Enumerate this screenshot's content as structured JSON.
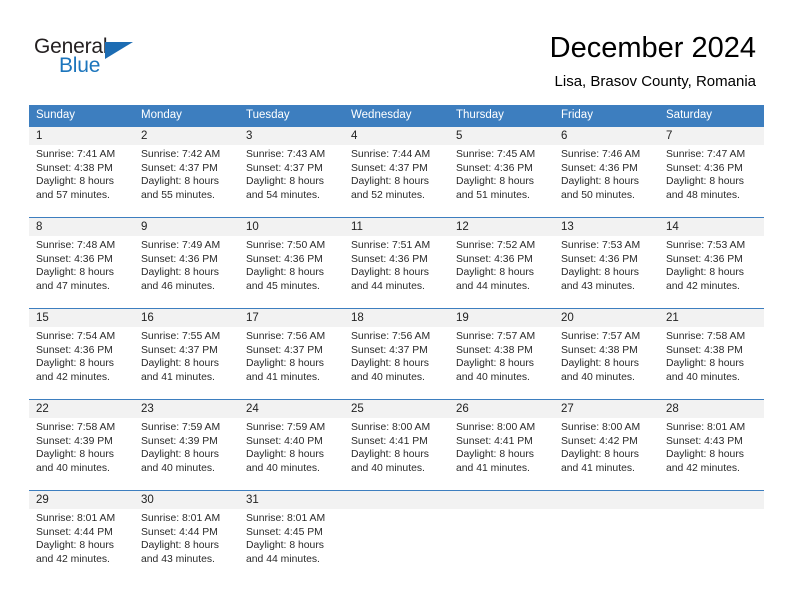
{
  "brand": {
    "name_top": "General",
    "name_bottom": "Blue",
    "triangle_color": "#1c6cb3",
    "blue_color": "#1c75bc"
  },
  "header": {
    "title": "December 2024",
    "subtitle": "Lisa, Brasov County, Romania"
  },
  "theme": {
    "header_bg": "#3d7ebf",
    "daynum_bg": "#f2f2f2",
    "cell_bg": "#ffffff",
    "text": "#2a2a2a"
  },
  "weekdays": [
    "Sunday",
    "Monday",
    "Tuesday",
    "Wednesday",
    "Thursday",
    "Friday",
    "Saturday"
  ],
  "weeks": [
    [
      {
        "day": "1",
        "sunrise": "Sunrise: 7:41 AM",
        "sunset": "Sunset: 4:38 PM",
        "daylight1": "Daylight: 8 hours",
        "daylight2": "and 57 minutes."
      },
      {
        "day": "2",
        "sunrise": "Sunrise: 7:42 AM",
        "sunset": "Sunset: 4:37 PM",
        "daylight1": "Daylight: 8 hours",
        "daylight2": "and 55 minutes."
      },
      {
        "day": "3",
        "sunrise": "Sunrise: 7:43 AM",
        "sunset": "Sunset: 4:37 PM",
        "daylight1": "Daylight: 8 hours",
        "daylight2": "and 54 minutes."
      },
      {
        "day": "4",
        "sunrise": "Sunrise: 7:44 AM",
        "sunset": "Sunset: 4:37 PM",
        "daylight1": "Daylight: 8 hours",
        "daylight2": "and 52 minutes."
      },
      {
        "day": "5",
        "sunrise": "Sunrise: 7:45 AM",
        "sunset": "Sunset: 4:36 PM",
        "daylight1": "Daylight: 8 hours",
        "daylight2": "and 51 minutes."
      },
      {
        "day": "6",
        "sunrise": "Sunrise: 7:46 AM",
        "sunset": "Sunset: 4:36 PM",
        "daylight1": "Daylight: 8 hours",
        "daylight2": "and 50 minutes."
      },
      {
        "day": "7",
        "sunrise": "Sunrise: 7:47 AM",
        "sunset": "Sunset: 4:36 PM",
        "daylight1": "Daylight: 8 hours",
        "daylight2": "and 48 minutes."
      }
    ],
    [
      {
        "day": "8",
        "sunrise": "Sunrise: 7:48 AM",
        "sunset": "Sunset: 4:36 PM",
        "daylight1": "Daylight: 8 hours",
        "daylight2": "and 47 minutes."
      },
      {
        "day": "9",
        "sunrise": "Sunrise: 7:49 AM",
        "sunset": "Sunset: 4:36 PM",
        "daylight1": "Daylight: 8 hours",
        "daylight2": "and 46 minutes."
      },
      {
        "day": "10",
        "sunrise": "Sunrise: 7:50 AM",
        "sunset": "Sunset: 4:36 PM",
        "daylight1": "Daylight: 8 hours",
        "daylight2": "and 45 minutes."
      },
      {
        "day": "11",
        "sunrise": "Sunrise: 7:51 AM",
        "sunset": "Sunset: 4:36 PM",
        "daylight1": "Daylight: 8 hours",
        "daylight2": "and 44 minutes."
      },
      {
        "day": "12",
        "sunrise": "Sunrise: 7:52 AM",
        "sunset": "Sunset: 4:36 PM",
        "daylight1": "Daylight: 8 hours",
        "daylight2": "and 44 minutes."
      },
      {
        "day": "13",
        "sunrise": "Sunrise: 7:53 AM",
        "sunset": "Sunset: 4:36 PM",
        "daylight1": "Daylight: 8 hours",
        "daylight2": "and 43 minutes."
      },
      {
        "day": "14",
        "sunrise": "Sunrise: 7:53 AM",
        "sunset": "Sunset: 4:36 PM",
        "daylight1": "Daylight: 8 hours",
        "daylight2": "and 42 minutes."
      }
    ],
    [
      {
        "day": "15",
        "sunrise": "Sunrise: 7:54 AM",
        "sunset": "Sunset: 4:36 PM",
        "daylight1": "Daylight: 8 hours",
        "daylight2": "and 42 minutes."
      },
      {
        "day": "16",
        "sunrise": "Sunrise: 7:55 AM",
        "sunset": "Sunset: 4:37 PM",
        "daylight1": "Daylight: 8 hours",
        "daylight2": "and 41 minutes."
      },
      {
        "day": "17",
        "sunrise": "Sunrise: 7:56 AM",
        "sunset": "Sunset: 4:37 PM",
        "daylight1": "Daylight: 8 hours",
        "daylight2": "and 41 minutes."
      },
      {
        "day": "18",
        "sunrise": "Sunrise: 7:56 AM",
        "sunset": "Sunset: 4:37 PM",
        "daylight1": "Daylight: 8 hours",
        "daylight2": "and 40 minutes."
      },
      {
        "day": "19",
        "sunrise": "Sunrise: 7:57 AM",
        "sunset": "Sunset: 4:38 PM",
        "daylight1": "Daylight: 8 hours",
        "daylight2": "and 40 minutes."
      },
      {
        "day": "20",
        "sunrise": "Sunrise: 7:57 AM",
        "sunset": "Sunset: 4:38 PM",
        "daylight1": "Daylight: 8 hours",
        "daylight2": "and 40 minutes."
      },
      {
        "day": "21",
        "sunrise": "Sunrise: 7:58 AM",
        "sunset": "Sunset: 4:38 PM",
        "daylight1": "Daylight: 8 hours",
        "daylight2": "and 40 minutes."
      }
    ],
    [
      {
        "day": "22",
        "sunrise": "Sunrise: 7:58 AM",
        "sunset": "Sunset: 4:39 PM",
        "daylight1": "Daylight: 8 hours",
        "daylight2": "and 40 minutes."
      },
      {
        "day": "23",
        "sunrise": "Sunrise: 7:59 AM",
        "sunset": "Sunset: 4:39 PM",
        "daylight1": "Daylight: 8 hours",
        "daylight2": "and 40 minutes."
      },
      {
        "day": "24",
        "sunrise": "Sunrise: 7:59 AM",
        "sunset": "Sunset: 4:40 PM",
        "daylight1": "Daylight: 8 hours",
        "daylight2": "and 40 minutes."
      },
      {
        "day": "25",
        "sunrise": "Sunrise: 8:00 AM",
        "sunset": "Sunset: 4:41 PM",
        "daylight1": "Daylight: 8 hours",
        "daylight2": "and 40 minutes."
      },
      {
        "day": "26",
        "sunrise": "Sunrise: 8:00 AM",
        "sunset": "Sunset: 4:41 PM",
        "daylight1": "Daylight: 8 hours",
        "daylight2": "and 41 minutes."
      },
      {
        "day": "27",
        "sunrise": "Sunrise: 8:00 AM",
        "sunset": "Sunset: 4:42 PM",
        "daylight1": "Daylight: 8 hours",
        "daylight2": "and 41 minutes."
      },
      {
        "day": "28",
        "sunrise": "Sunrise: 8:01 AM",
        "sunset": "Sunset: 4:43 PM",
        "daylight1": "Daylight: 8 hours",
        "daylight2": "and 42 minutes."
      }
    ],
    [
      {
        "day": "29",
        "sunrise": "Sunrise: 8:01 AM",
        "sunset": "Sunset: 4:44 PM",
        "daylight1": "Daylight: 8 hours",
        "daylight2": "and 42 minutes."
      },
      {
        "day": "30",
        "sunrise": "Sunrise: 8:01 AM",
        "sunset": "Sunset: 4:44 PM",
        "daylight1": "Daylight: 8 hours",
        "daylight2": "and 43 minutes."
      },
      {
        "day": "31",
        "sunrise": "Sunrise: 8:01 AM",
        "sunset": "Sunset: 4:45 PM",
        "daylight1": "Daylight: 8 hours",
        "daylight2": "and 44 minutes."
      },
      {
        "day": "",
        "sunrise": "",
        "sunset": "",
        "daylight1": "",
        "daylight2": ""
      },
      {
        "day": "",
        "sunrise": "",
        "sunset": "",
        "daylight1": "",
        "daylight2": ""
      },
      {
        "day": "",
        "sunrise": "",
        "sunset": "",
        "daylight1": "",
        "daylight2": ""
      },
      {
        "day": "",
        "sunrise": "",
        "sunset": "",
        "daylight1": "",
        "daylight2": ""
      }
    ]
  ]
}
